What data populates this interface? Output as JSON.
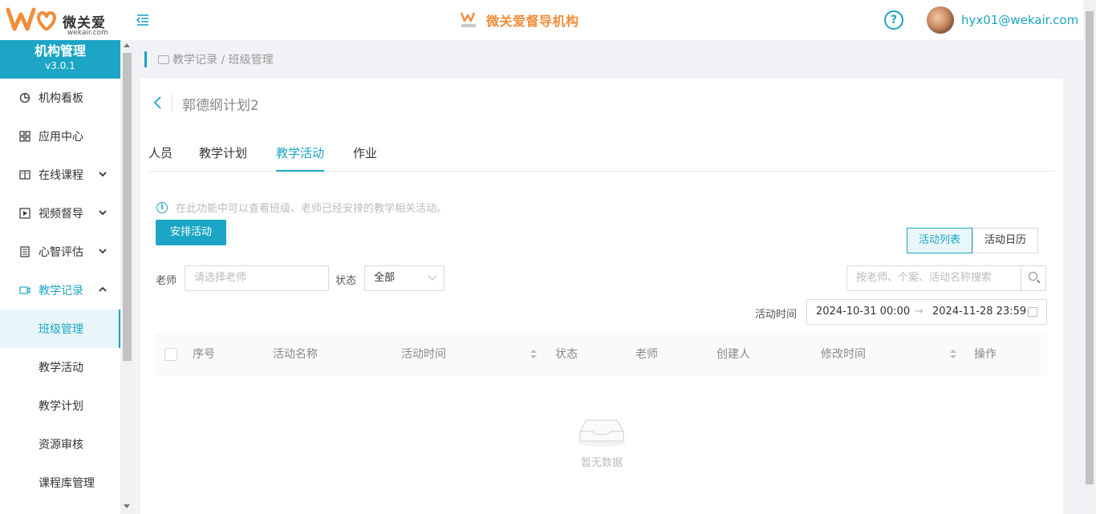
{
  "header": {
    "logo_text": "微关爱",
    "logo_sub": "wekair.com",
    "brand_title": "微关爱督导机构",
    "help_symbol": "?",
    "user_email": "hyx01@wekair.com"
  },
  "sidebar": {
    "title": "机构管理",
    "version": "v3.0.1",
    "items": [
      {
        "label": "机构看板",
        "icon": "pie-chart-icon"
      },
      {
        "label": "应用中心",
        "icon": "grid-icon"
      },
      {
        "label": "在线课程",
        "icon": "book-icon",
        "expandable": true
      },
      {
        "label": "视频督导",
        "icon": "play-icon",
        "expandable": true
      },
      {
        "label": "心智评估",
        "icon": "document-icon",
        "expandable": true
      },
      {
        "label": "教学记录",
        "icon": "video-icon",
        "expandable": true,
        "expanded": true
      }
    ],
    "sub_items": [
      "班级管理",
      "教学活动",
      "教学计划",
      "资源审核",
      "课程库管理"
    ]
  },
  "breadcrumb": "教学记录 / 班级管理",
  "page": {
    "title": "郭德纲计划2",
    "tabs": [
      "人员",
      "教学计划",
      "教学活动",
      "作业"
    ],
    "active_tab": "教学活动",
    "info": "在此功能中可以查看班级、老师已经安排的教学相关活动。",
    "arrange_button": "安排活动",
    "view_toggle": {
      "list": "活动列表",
      "calendar": "活动日历"
    },
    "filters": {
      "teacher_label": "老师",
      "teacher_placeholder": "请选择老师",
      "status_label": "状态",
      "status_value": "全部",
      "search_placeholder": "按老师、个案、活动名称搜索",
      "time_label": "活动时间",
      "date_start": "2024-10-31 00:00",
      "date_end": "2024-11-28 23:59"
    },
    "table": {
      "columns": [
        "序号",
        "活动名称",
        "活动时间",
        "状态",
        "老师",
        "创建人",
        "修改时间",
        "操作"
      ]
    },
    "empty_text": "暂无数据"
  },
  "colors": {
    "accent": "#1ca5c4",
    "brand_orange": "#f08c3a"
  }
}
